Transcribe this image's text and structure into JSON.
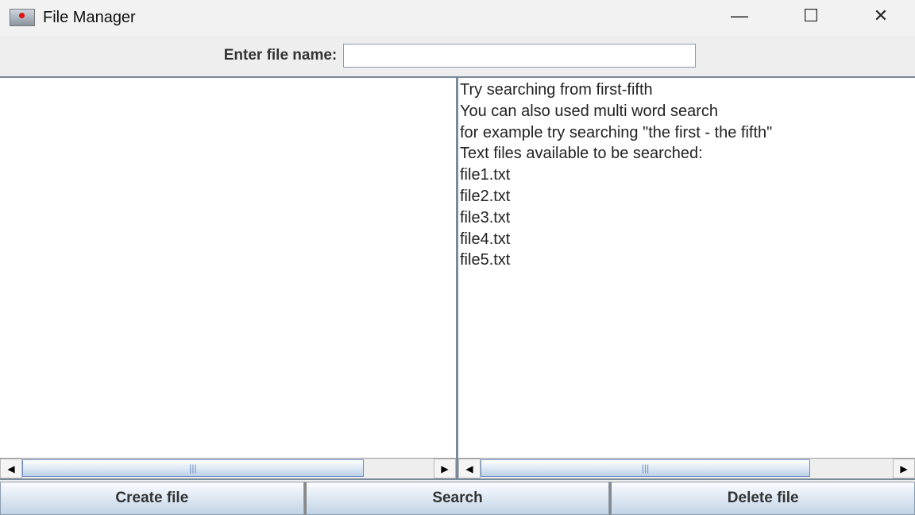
{
  "window": {
    "title": "File Manager"
  },
  "header": {
    "label": "Enter file name:",
    "input_value": ""
  },
  "output_lines": [
    "Try searching from first-fifth",
    "You can also used multi word search",
    "for example try searching \"the first - the fifth\"",
    "Text files available to be searched:",
    "file1.txt",
    "file2.txt",
    "file3.txt",
    "file4.txt",
    "file5.txt"
  ],
  "scroll": {
    "left_fraction": 0.83,
    "right_fraction": 0.8
  },
  "buttons": {
    "create": "Create file",
    "search": "Search",
    "delete": "Delete file"
  }
}
